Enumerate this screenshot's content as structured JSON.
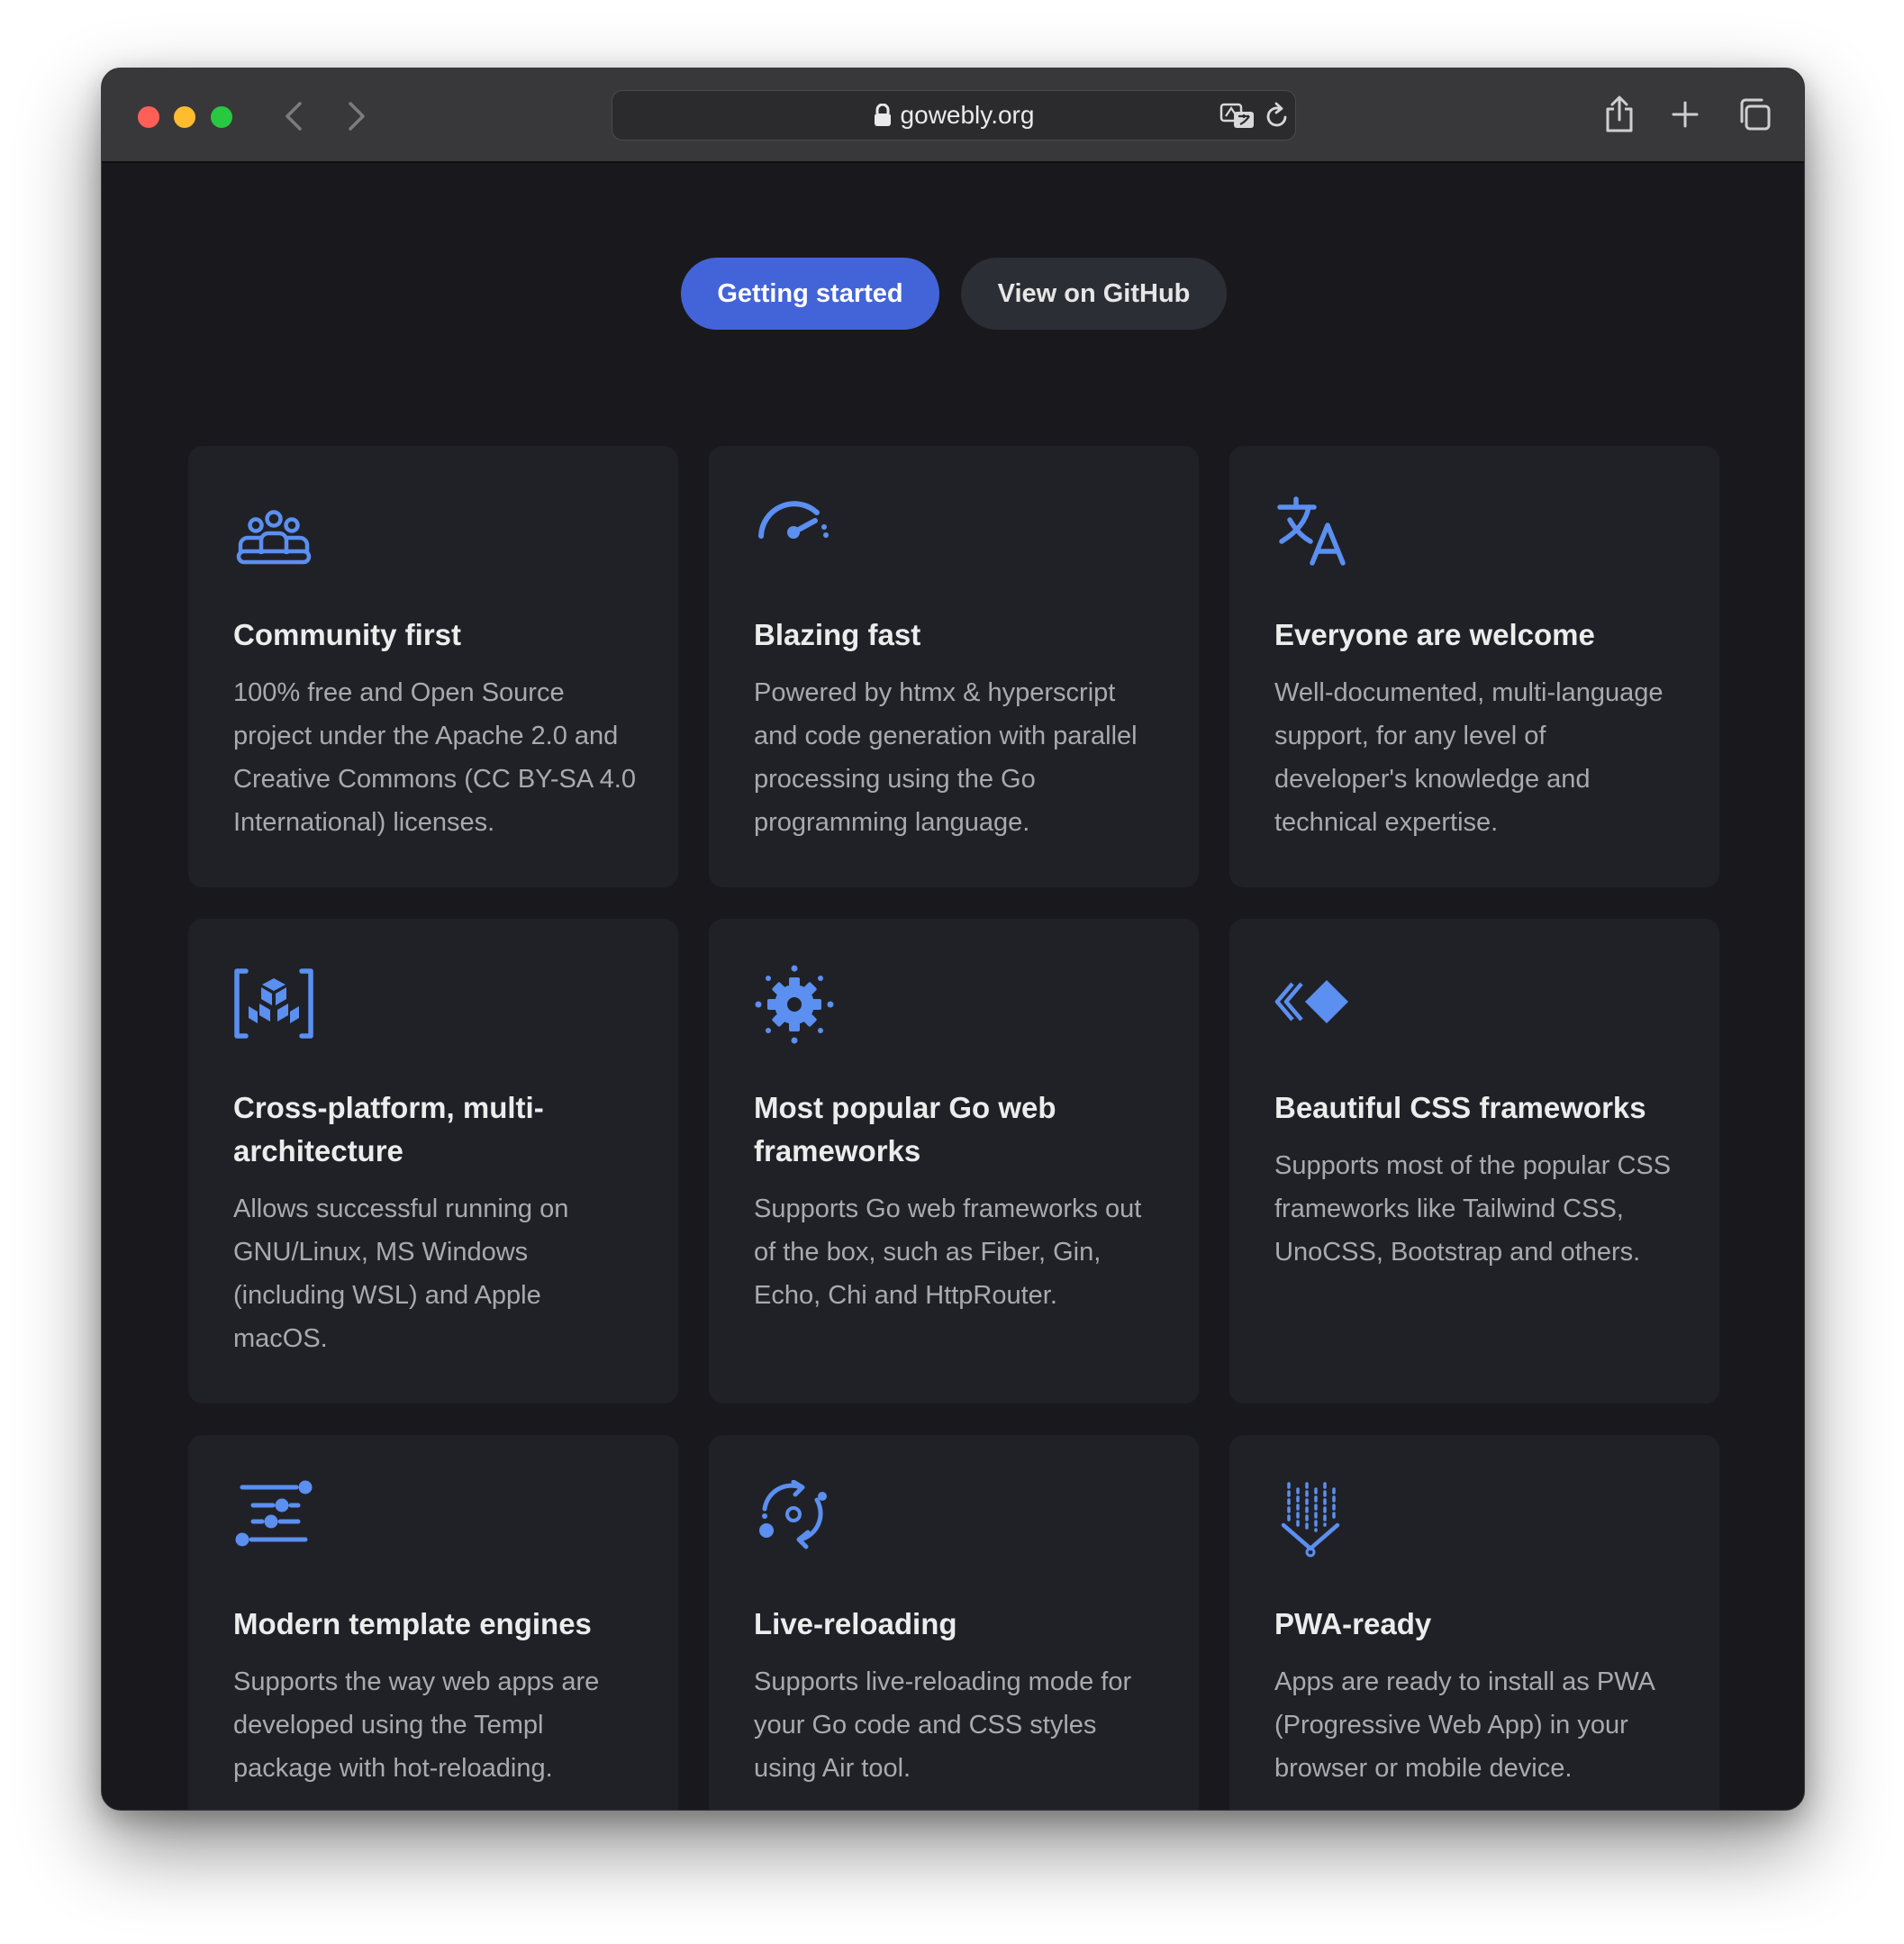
{
  "browser": {
    "url": "gowebly.org"
  },
  "hero": {
    "primary_button": "Getting started",
    "secondary_button": "View on GitHub"
  },
  "colors": {
    "accent": "#4364d8",
    "icon": "#5b8ff0",
    "card_bg": "#202127",
    "page_bg": "#19191d"
  },
  "features": [
    {
      "icon": "community-icon",
      "title": "Community first",
      "description": "100% free and Open Source project under the Apache 2.0 and Creative Commons (CC BY-SA 4.0 International) licenses."
    },
    {
      "icon": "speedometer-icon",
      "title": "Blazing fast",
      "description": "Powered by htmx & hyperscript and code generation with parallel processing using the Go programming language."
    },
    {
      "icon": "translate-icon",
      "title": "Everyone are welcome",
      "description": "Well-documented, multi-language support, for any level of developer's knowledge and technical expertise."
    },
    {
      "icon": "cubes-icon",
      "title": "Cross-platform, multi-architecture",
      "description": "Allows successful running on GNU/Linux, MS Windows (including WSL) and Apple macOS."
    },
    {
      "icon": "gear-icon",
      "title": "Most popular Go web frameworks",
      "description": "Supports Go web frameworks out of the box, such as Fiber, Gin, Echo, Chi and HttpRouter."
    },
    {
      "icon": "diamond-icon",
      "title": "Beautiful CSS frameworks",
      "description": "Supports most of the popular CSS frameworks like Tailwind CSS, UnoCSS, Bootstrap and others."
    },
    {
      "icon": "template-icon",
      "title": "Modern template engines",
      "description": "Supports the way web apps are developed using the Templ package with hot-reloading."
    },
    {
      "icon": "reload-icon",
      "title": "Live-reloading",
      "description": "Supports live-reloading mode for your Go code and CSS styles using Air tool."
    },
    {
      "icon": "download-icon",
      "title": "PWA-ready",
      "description": "Apps are ready to install as PWA (Progressive Web App) in your browser or mobile device."
    }
  ]
}
